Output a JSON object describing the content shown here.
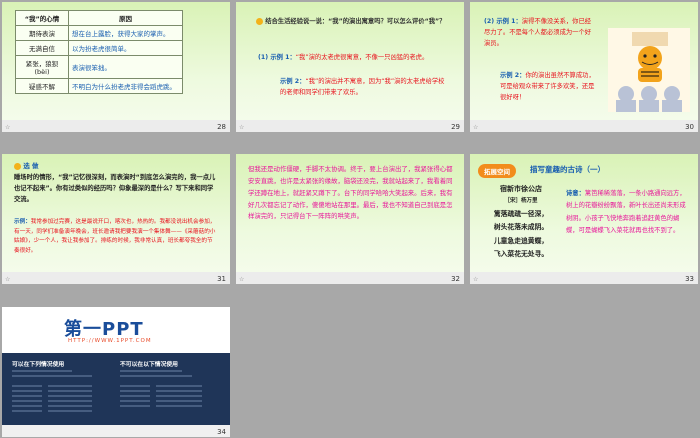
{
  "slides": {
    "s28": {
      "number": "28",
      "header_mood": "“我”的心情",
      "header_reason": "原因",
      "rows": [
        {
          "mood": "期待表演",
          "reason": "想在台上露脸，获得大家的掌声。"
        },
        {
          "mood": "无满自信",
          "reason": "以为扮老虎很简单。"
        },
        {
          "mood": "紧张，狼狈(bèi)",
          "reason": "表演很笨拙。"
        },
        {
          "mood": "疑惑不解",
          "reason": "不明白为什么扮老虎非得会蹈虎跳。"
        }
      ]
    },
    "s29": {
      "number": "29",
      "question": "结合生活经验说一说：“我”的演出寓意吗？可以怎么评价“我”？",
      "ex1_label": "(1) 示例 1：",
      "ex1_text": "“我”演的太老虎很寓意，不像一只凶猛的老虎。",
      "ex2_label": "示例 2：",
      "ex2_text": "“我”的演出并不寓意，因为“我”演的太老虎给学校的老师和同学们带来了欢乐。"
    },
    "s30": {
      "number": "30",
      "ex1_label": "(2) 示例 1：",
      "ex1_text": "演得不像没关系，你已经尽力了。不是每个人都必须成为一个好演员。",
      "ex2_label": "示例 2：",
      "ex2_text": "你的演出虽然不算成功，可是给观众带来了许多欢笑，还是很好呀！"
    },
    "s31": {
      "number": "31",
      "section": "选 做",
      "body": "睡场时的情形，“我”记忆很深刻，而表演时“到底怎么演完的，我一点儿也记不起来”。你有过类似的经历吗？仰象最深的是什么？写下来和同学交流。",
      "example_label": "示例：",
      "example_text": "我常参加过完赛，这是最说开口，喀次也，热热的。我都没说出机会参加，有一天，同学们准备演年晚会，班长邀请我把要我演一个集体舞——《采蘑菇的小姑娘》，少一个人，我让我参加了。排练的时候，我非常认真，班长都夸我全的节奏很好。"
    },
    "s32": {
      "number": "32",
      "text": "但我还是动作僵硬，手脚不太协调。终于，要上台演出了，我紧张得心都安安直跳，也许是太紧张的缘故，脑袋还没完，我就站起来了，我看着同学还蹲在地上，就赶紧又蹲下了。台下的同学哈哈大笑起来。后来，我有好几次都忘记了动作，傻傻地站在那里。最后，我也不知道自己到底是怎样演完的，只记得台下一阵阵的哄笑声。"
    },
    "s33": {
      "number": "33",
      "badge": "拓展空间",
      "title": "描写童趣的古诗（一）",
      "poem_title": "宿新市徐公店",
      "poem_author": "［宋］杨万里",
      "poem_lines": [
        "篱落疏疏一径深，",
        "树头花落未成阴。",
        "儿童急走追黄蝶，",
        "飞入菜花无处寻。"
      ],
      "note_label": "诗意：",
      "note_text": "篱笆稀稀落落，一条小路通向远方，树上的花瓣纷纷飘落，新叶长出还尚未形成树阴。小孩子飞快地奔跑着追赶黄色的蝴蝶，可是蝴蝶飞入菜花就再也找不到了。"
    },
    "s34": {
      "number": "34",
      "logo": "第一PPT",
      "url": "HTTP://WWW.1PPT.COM",
      "can_title": "可以在下列情况使用",
      "cannot_title": "不可以在以下情况使用"
    }
  }
}
